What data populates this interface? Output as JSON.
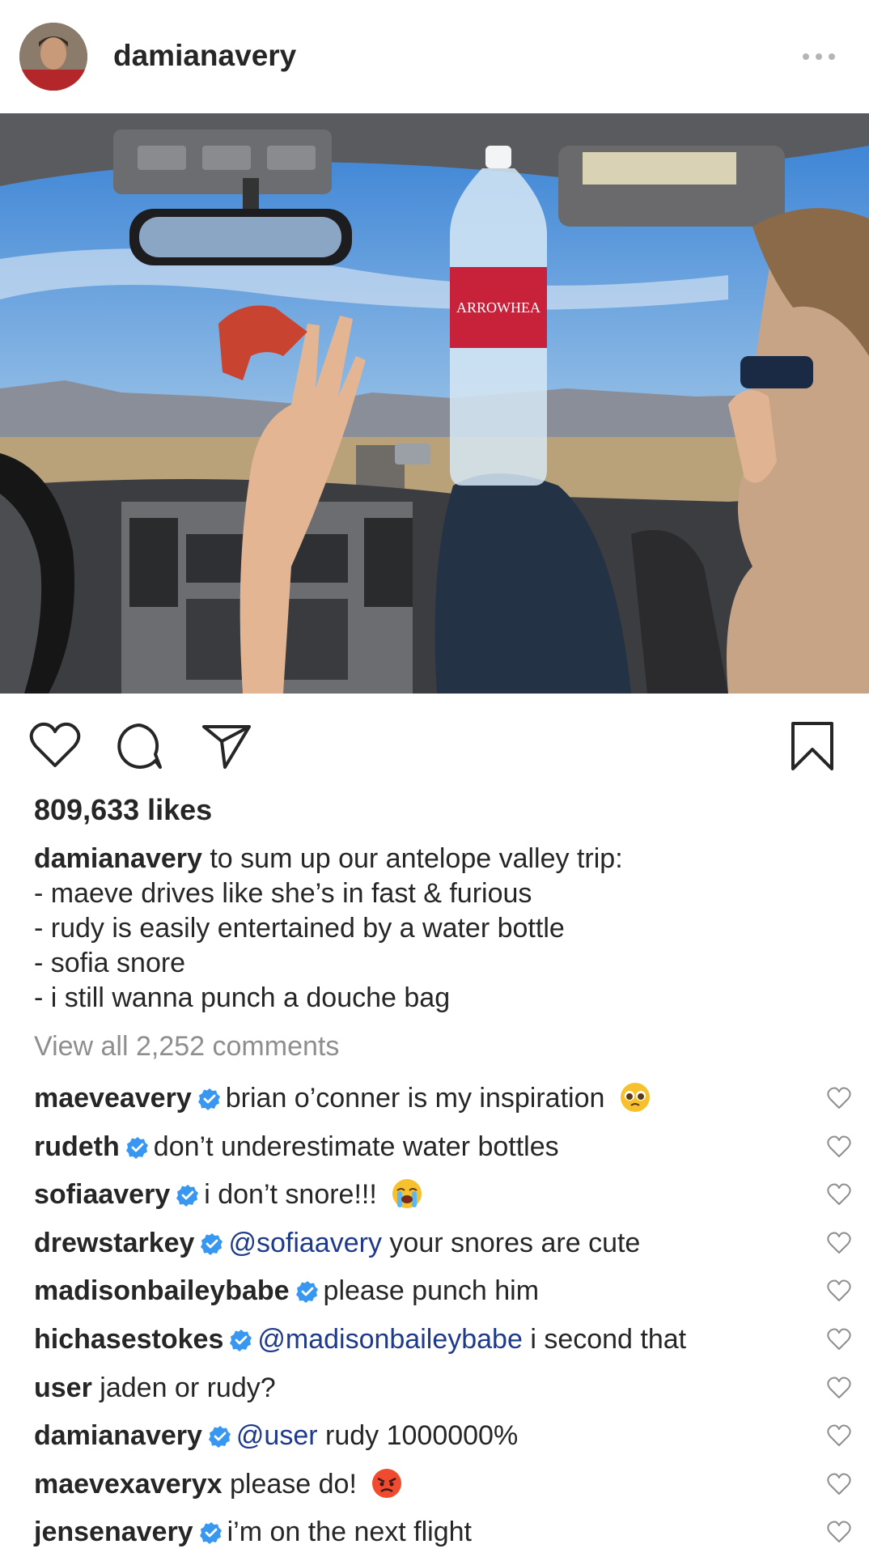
{
  "post": {
    "username": "damianavery",
    "likes_text": "809,633 likes",
    "caption": {
      "username": "damianavery",
      "first_line": " to sum up our antelope valley trip:",
      "lines": [
        "- maeve drives like she’s in fast & furious",
        "- rudy is easily entertained by a water bottle",
        "- sofia snore",
        "- i still wanna punch a douche bag"
      ]
    },
    "view_all_comments": "View all 2,252 comments",
    "photo": {
      "bottle_label": "ARROWHEA"
    }
  },
  "comments": [
    {
      "user": "maeveavery",
      "verified": true,
      "mention": "",
      "text": "brian o’conner is my inspiration",
      "emoji": "pleading-face"
    },
    {
      "user": "rudeth",
      "verified": true,
      "mention": "",
      "text": "don’t underestimate water bottles",
      "emoji": ""
    },
    {
      "user": "sofiaavery",
      "verified": true,
      "mention": "",
      "text": "i don’t snore!!!",
      "emoji": "loudly-crying-face"
    },
    {
      "user": "drewstarkey",
      "verified": true,
      "mention": "@sofiaavery",
      "text": "your snores are cute",
      "emoji": ""
    },
    {
      "user": "madisonbaileybabe",
      "verified": true,
      "mention": "",
      "text": "please punch him",
      "emoji": ""
    },
    {
      "user": "hichasestokes",
      "verified": true,
      "mention": "@madisonbaileybabe",
      "text": "i second that",
      "emoji": ""
    },
    {
      "user": "user",
      "verified": false,
      "mention": "",
      "text": "jaden or rudy?",
      "emoji": ""
    },
    {
      "user": "damianavery",
      "verified": true,
      "mention": "@user",
      "text": "rudy 1000000%",
      "emoji": ""
    },
    {
      "user": "maevexaveryx",
      "verified": false,
      "mention": "",
      "text": "please do!",
      "emoji": "angry-face"
    },
    {
      "user": "jensenavery",
      "verified": true,
      "mention": "",
      "text": "i’m on the next flight",
      "emoji": ""
    }
  ],
  "icons": {
    "like": "heart-outline-icon",
    "comment": "speech-bubble-icon",
    "share": "paper-plane-icon",
    "save": "bookmark-icon",
    "more": "ellipsis-icon",
    "verified": "verified-badge-icon",
    "comment_like": "heart-outline-icon"
  },
  "colors": {
    "text": "#262626",
    "muted": "#8e8e8e",
    "mention": "#1e3a8a",
    "verified": "#3897f0"
  }
}
